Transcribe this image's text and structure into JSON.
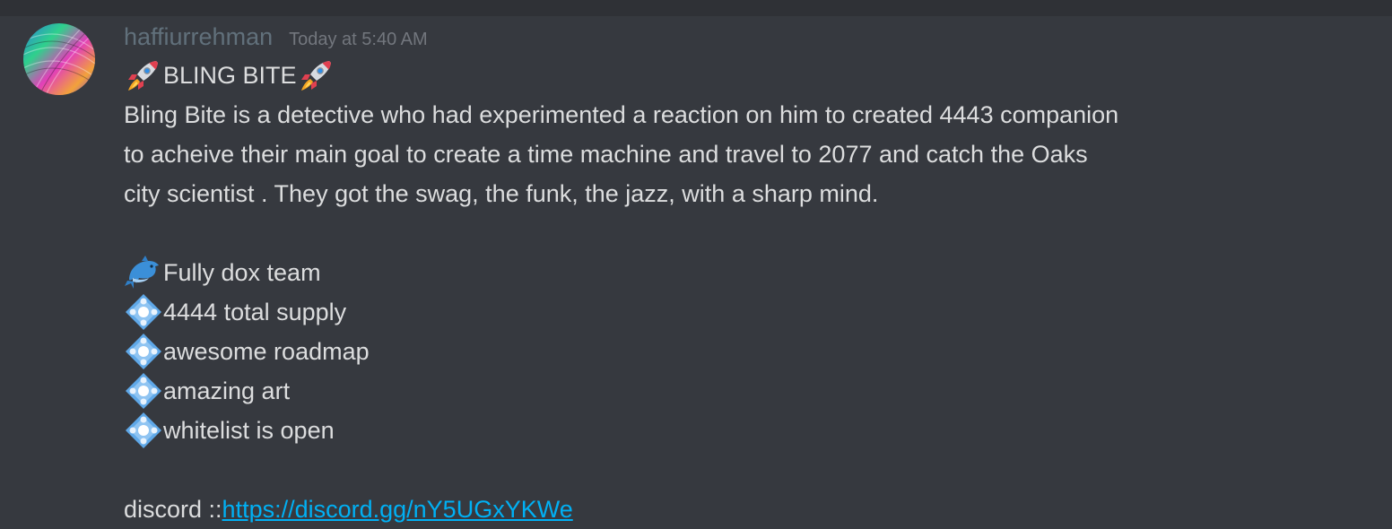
{
  "message": {
    "username": "haffiurrehman",
    "timestamp": "Today at 5:40 AM",
    "title_text": "BLING BITE",
    "title_icons": [
      "rocket-icon",
      "rocket-icon"
    ],
    "description_lines": [
      "Bling Bite is a detective who had experimented a reaction on him to created 4443 companion",
      "to acheive their main goal to create a time machine and travel to 2077 and catch the Oaks",
      "city scientist . They got the swag, the funk, the jazz, with a sharp mind."
    ],
    "features": [
      {
        "icon": "dolphin-icon",
        "text": "Fully dox team"
      },
      {
        "icon": "diamond-icon",
        "text": "4444 total supply"
      },
      {
        "icon": "diamond-icon",
        "text": "awesome roadmap"
      },
      {
        "icon": "diamond-icon",
        "text": "amazing art"
      },
      {
        "icon": "diamond-icon",
        "text": "whitelist is open"
      }
    ],
    "discord_label": "discord ::",
    "discord_link": "https://discord.gg/nY5UGxYKWe"
  },
  "colors": {
    "background": "#36393f",
    "top_bar": "#2f3136",
    "username": "#61707b",
    "timestamp": "#72767d",
    "text": "#dcddde",
    "link": "#00b0f4"
  }
}
